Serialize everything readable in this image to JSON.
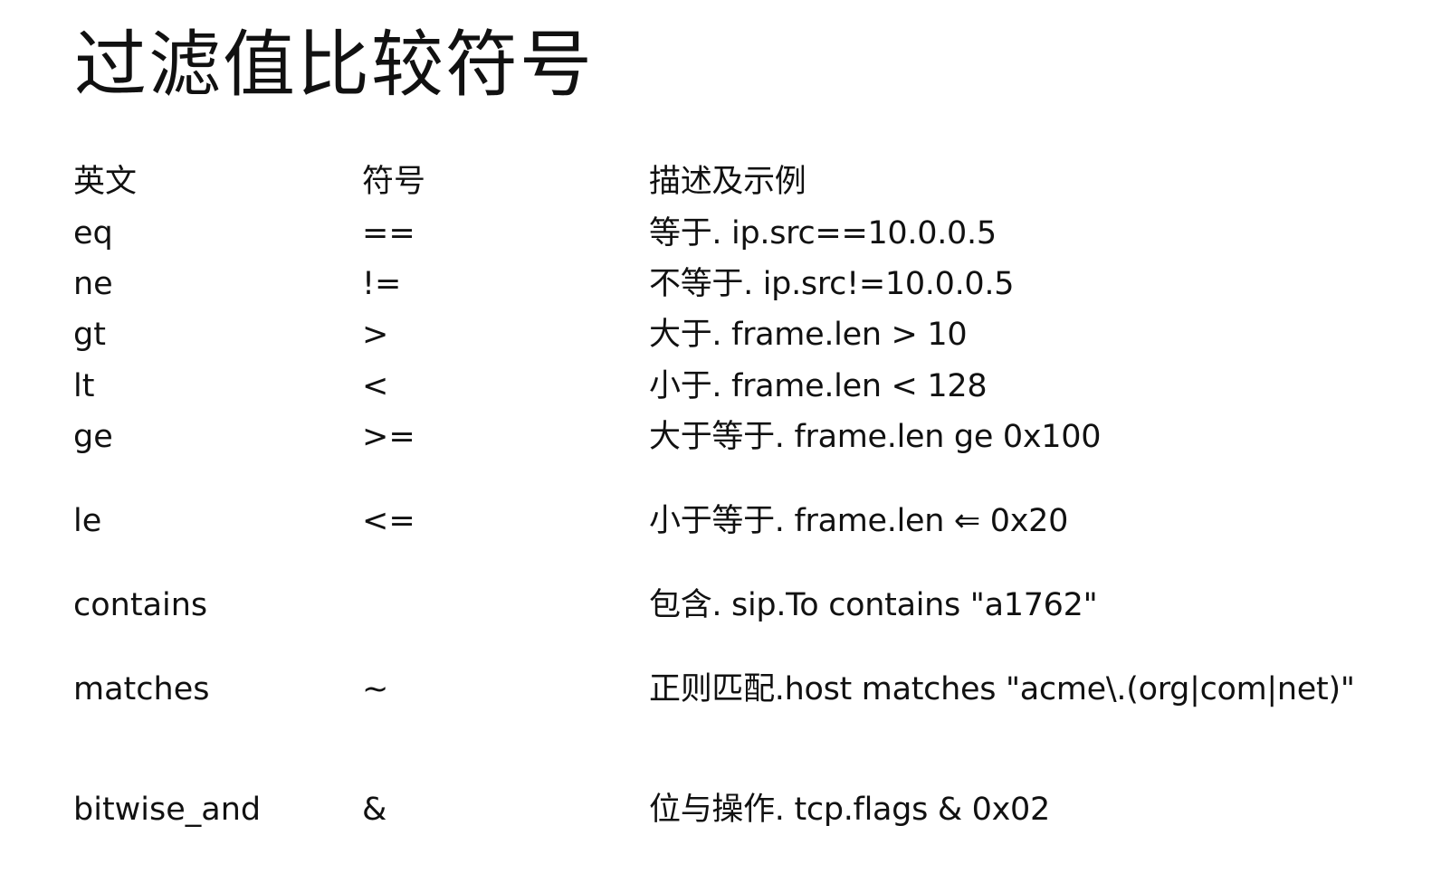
{
  "title": "过滤值比较符号",
  "table": {
    "headers": {
      "english": "英文",
      "symbol": "符号",
      "description": "描述及示例"
    },
    "rows": [
      {
        "english": "eq",
        "symbol": "==",
        "description": "等于. ip.src==10.0.0.5"
      },
      {
        "english": "ne",
        "symbol": "!=",
        "description": "不等于. ip.src!=10.0.0.5"
      },
      {
        "english": "gt",
        "symbol": ">",
        "description": "大于. frame.len > 10"
      },
      {
        "english": "lt",
        "symbol": "<",
        "description": "小于. frame.len < 128"
      },
      {
        "english": "ge",
        "symbol": ">=",
        "description": "大于等于. frame.len ge 0x100"
      },
      {
        "english": "le",
        "symbol": "<=",
        "description": "小于等于. frame.len ⇐  0x20"
      },
      {
        "english": "contains",
        "symbol": "",
        "description": "包含. sip.To contains \"a1762\""
      },
      {
        "english": "matches",
        "symbol": "~",
        "description": "正则匹配.host matches \"acme\\.(org|com|net)\""
      },
      {
        "english": "bitwise_and",
        "symbol": "&",
        "description": "位与操作. tcp.flags & 0x02"
      }
    ]
  }
}
